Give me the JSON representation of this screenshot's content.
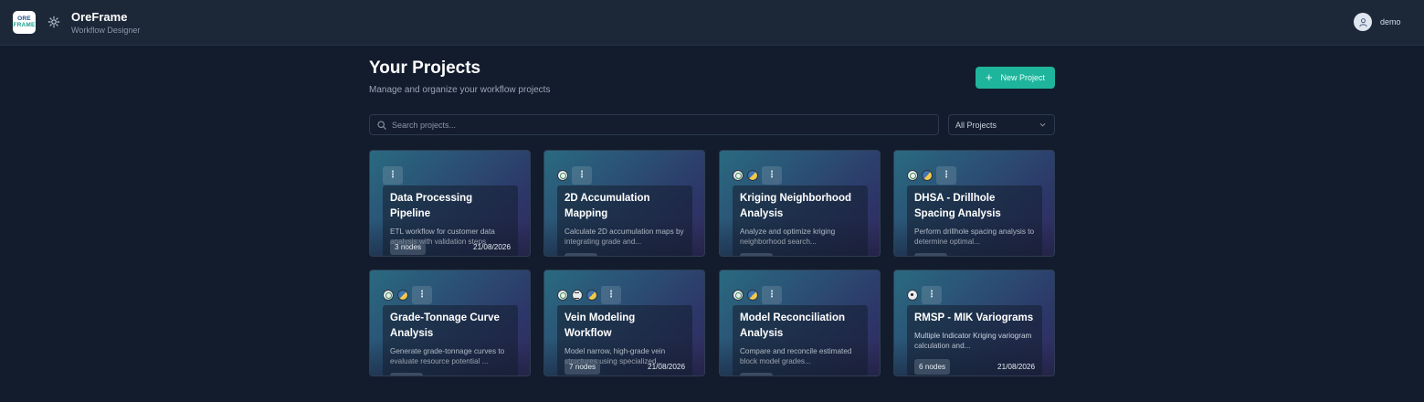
{
  "header": {
    "logo_line1": "ORE",
    "logo_line2": "FRAME",
    "app_title": "OreFrame",
    "app_subtitle": "Workflow Designer",
    "username": "demo"
  },
  "main": {
    "title": "Your Projects",
    "subtitle": "Manage and organize your workflow projects",
    "new_project_label": "New Project",
    "search_placeholder": "Search projects...",
    "filter_value": "All Projects"
  },
  "colors": {
    "accent": "#1fb59d",
    "background": "#121c2c",
    "header": "#1c2738"
  },
  "projects": [
    {
      "title": "Data Processing Pipeline",
      "description": "ETL workflow for customer data analysis with validation steps",
      "nodes": "3 nodes",
      "date": "21/08/2026",
      "tech_icons": []
    },
    {
      "title": "2D Accumulation Mapping",
      "description": "Calculate 2D accumulation maps by integrating grade and...",
      "nodes": "",
      "date": "",
      "tech_icons": [
        "check-circle-icon"
      ]
    },
    {
      "title": "Kriging Neighborhood Analysis",
      "description": "Analyze and optimize kriging neighborhood search...",
      "nodes": "",
      "date": "",
      "tech_icons": [
        "check-circle-icon",
        "python-icon"
      ]
    },
    {
      "title": "DHSA - Drillhole Spacing Analysis",
      "description": "Perform drillhole spacing analysis to determine optimal...",
      "nodes": "",
      "date": "",
      "tech_icons": [
        "check-circle-icon",
        "python-icon"
      ]
    },
    {
      "title": "Grade-Tonnage Curve Analysis",
      "description": "Generate grade-tonnage curves to evaluate resource potential ...",
      "nodes": "",
      "date": "",
      "tech_icons": [
        "check-circle-icon",
        "python-icon"
      ]
    },
    {
      "title": "Vein Modeling Workflow",
      "description": "Model narrow, high-grade vein structures using specialized...",
      "nodes": "7 nodes",
      "date": "21/08/2026",
      "tech_icons": [
        "check-circle-icon",
        "stack-icon",
        "python-icon"
      ]
    },
    {
      "title": "Model Reconciliation Analysis",
      "description": "Compare and reconcile estimated block model grades...",
      "nodes": "",
      "date": "",
      "tech_icons": [
        "check-circle-icon",
        "python-icon"
      ]
    },
    {
      "title": "RMSP - MIK Variograms",
      "description": "Multiple Indicator Kriging variogram calculation and...",
      "nodes": "6 nodes",
      "date": "21/08/2026",
      "tech_icons": [
        "target-icon"
      ]
    }
  ]
}
